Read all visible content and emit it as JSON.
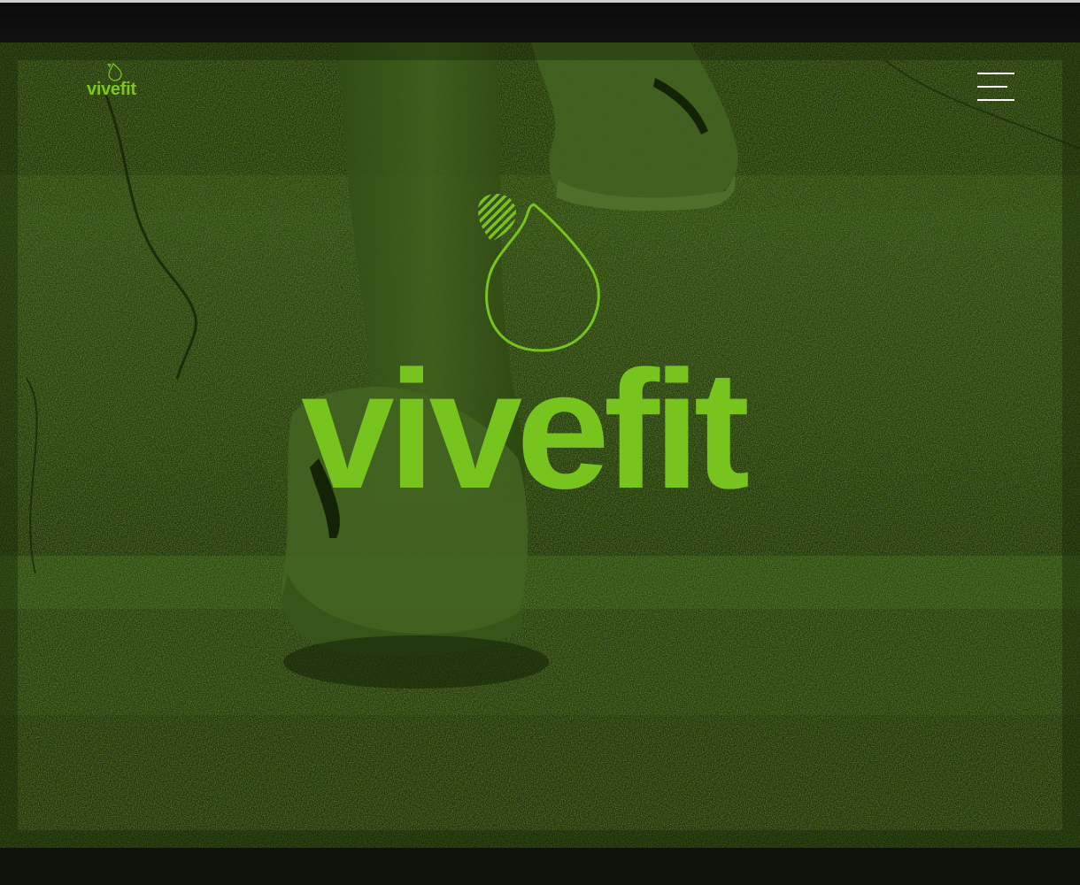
{
  "brand": {
    "name": "vivefit",
    "color": "#76c41d"
  },
  "header": {
    "logo_text": "vivefit",
    "menu_icon": "hamburger-menu-icon"
  },
  "hero": {
    "logo_text": "vivefit",
    "logo_icon": "water-drop-icon",
    "background": "runner-shoe-on-stairs-photo"
  },
  "colors": {
    "accent": "#76c41d",
    "overlay": "#264208",
    "menu_lines": "#ffffff"
  }
}
